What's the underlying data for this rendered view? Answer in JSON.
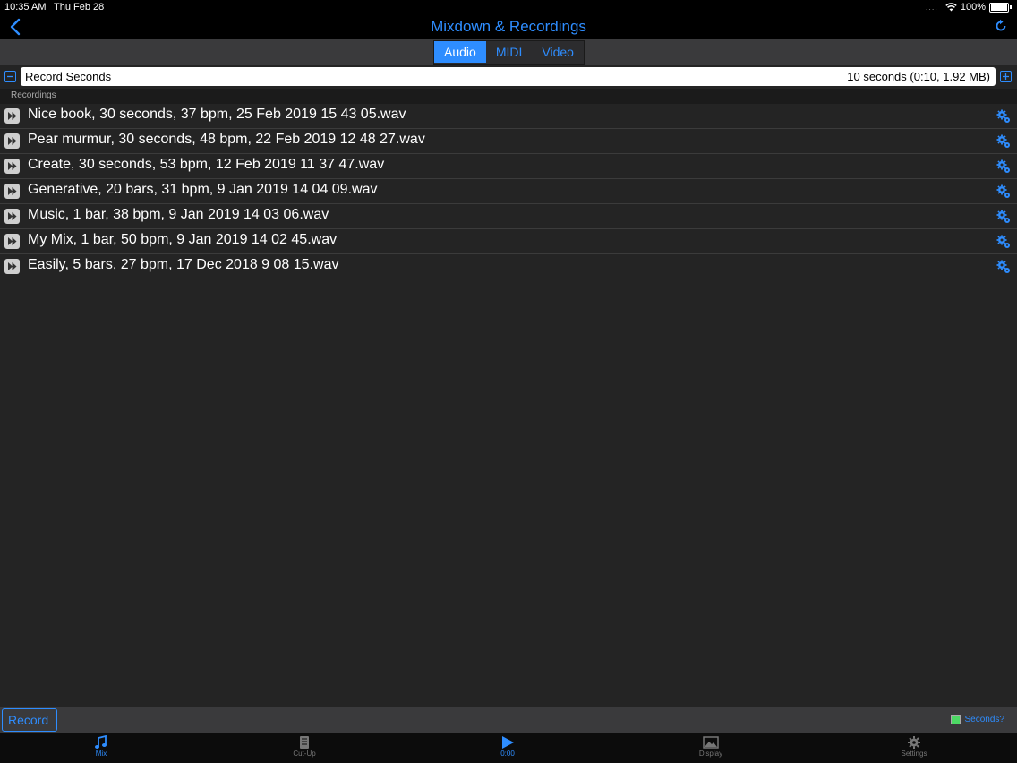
{
  "statusbar": {
    "time": "10:35 AM",
    "date": "Thu Feb 28",
    "battery": "100%"
  },
  "navbar": {
    "title": "Mixdown & Recordings",
    "back_icon": "chevron-left-icon",
    "refresh_icon": "refresh-icon"
  },
  "segments": [
    {
      "label": "Audio",
      "active": true
    },
    {
      "label": "MIDI",
      "active": false
    },
    {
      "label": "Video",
      "active": false
    }
  ],
  "record_seconds": {
    "label": "Record Seconds",
    "value": "10 seconds (0:10, 1.92 MB)"
  },
  "recordings_header": "Recordings",
  "recordings": [
    {
      "name": "Nice book, 30 seconds, 37 bpm, 25 Feb 2019 15 43 05.wav"
    },
    {
      "name": "Pear murmur, 30 seconds, 48 bpm, 22 Feb 2019 12 48 27.wav"
    },
    {
      "name": "Create, 30 seconds, 53 bpm, 12 Feb 2019 11 37 47.wav"
    },
    {
      "name": "Generative, 20 bars, 31 bpm, 9 Jan 2019 14 04 09.wav"
    },
    {
      "name": "Music, 1 bar, 38 bpm, 9 Jan 2019 14 03 06.wav"
    },
    {
      "name": "My Mix, 1 bar, 50 bpm, 9 Jan 2019 14 02 45.wav"
    },
    {
      "name": "Easily, 5 bars, 27 bpm, 17 Dec 2018 9 08 15.wav"
    }
  ],
  "bottombar": {
    "record_label": "Record",
    "seconds_label": "Seconds?"
  },
  "tabs": [
    {
      "label": "Mix",
      "icon": "music-note-icon",
      "active": true
    },
    {
      "label": "Cut-Up",
      "icon": "document-icon",
      "active": false
    },
    {
      "label": "0:00",
      "icon": "play-icon",
      "active": true
    },
    {
      "label": "Display",
      "icon": "image-icon",
      "active": false
    },
    {
      "label": "Settings",
      "icon": "gear-icon",
      "active": false
    }
  ],
  "colors": {
    "accent": "#2e8dff",
    "background": "#242424",
    "toolbar": "#3a3a3c"
  }
}
